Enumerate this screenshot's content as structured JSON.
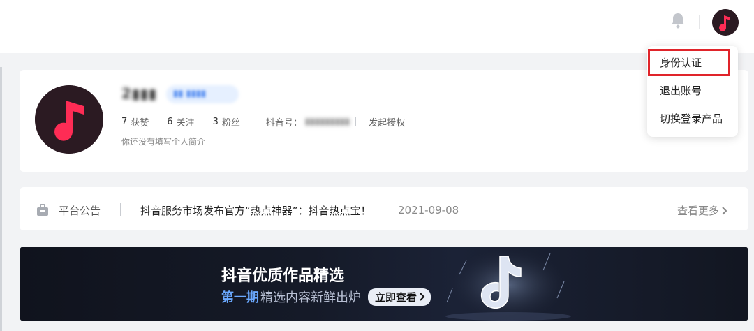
{
  "header": {
    "icons": [
      "bell-icon",
      "douyin-avatar"
    ]
  },
  "profile": {
    "username": "2▮▮▮",
    "tag": "▮▮ ▮▮▮▮",
    "stats": [
      {
        "num": "7",
        "label": "获赞"
      },
      {
        "num": "6",
        "label": "关注"
      },
      {
        "num": "3",
        "label": "粉丝"
      }
    ],
    "douyin_id_label": "抖音号：",
    "douyin_id_value": "▮▮▮▮▮▮▮▮▮",
    "auth_link": "发起授权",
    "bio": "你还没有填写个人简介"
  },
  "notice": {
    "label": "平台公告",
    "text": "抖音服务市场发布官方“热点神器”：抖音热点宝！",
    "date": "2021-09-08",
    "more": "查看更多"
  },
  "banner": {
    "title": "抖音优质作品精选",
    "highlight": "第一期",
    "subtitle": "精选内容新鲜出炉",
    "button": "立即查看"
  },
  "dropdown": {
    "items": [
      "身份认证",
      "退出账号",
      "切换登录产品"
    ],
    "highlight_color": "#e0242a"
  },
  "colors": {
    "accent": "#fe2c55",
    "link_blue": "#4a86f0"
  }
}
